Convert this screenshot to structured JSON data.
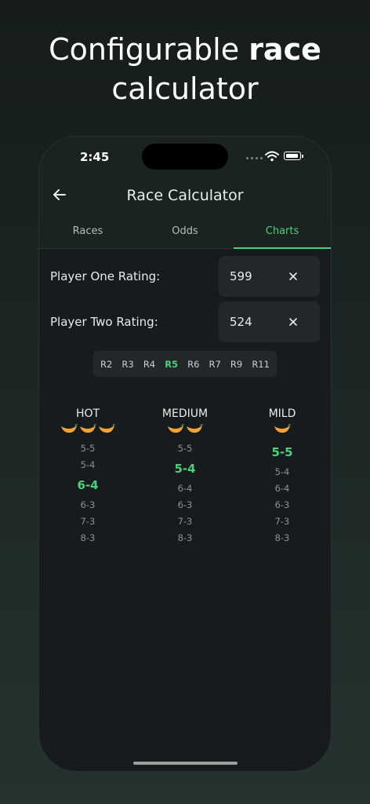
{
  "headline": {
    "regular": "Configurable ",
    "bold": "race",
    "line2": "calculator"
  },
  "status_bar": {
    "time": "2:45"
  },
  "header": {
    "title": "Race Calculator"
  },
  "tabs": [
    {
      "label": "Races",
      "active": false
    },
    {
      "label": "Odds",
      "active": false
    },
    {
      "label": "Charts",
      "active": true
    }
  ],
  "player_one": {
    "label": "Player One Rating:",
    "value": "599"
  },
  "player_two": {
    "label": "Player Two Rating:",
    "value": "524"
  },
  "races": [
    {
      "label": "R2",
      "active": false
    },
    {
      "label": "R3",
      "active": false
    },
    {
      "label": "R4",
      "active": false
    },
    {
      "label": "R5",
      "active": true
    },
    {
      "label": "R6",
      "active": false
    },
    {
      "label": "R7",
      "active": false
    },
    {
      "label": "R9",
      "active": false
    },
    {
      "label": "R11",
      "active": false
    }
  ],
  "columns": [
    {
      "title": "HOT",
      "peppers": 3,
      "entries": [
        "5-5",
        "5-4",
        "6-4",
        "6-3",
        "7-3",
        "8-3"
      ],
      "highlight": 2
    },
    {
      "title": "MEDIUM",
      "peppers": 2,
      "entries": [
        "5-5",
        "5-4",
        "6-4",
        "6-3",
        "7-3",
        "8-3"
      ],
      "highlight": 1
    },
    {
      "title": "MILD",
      "peppers": 1,
      "entries": [
        "5-5",
        "5-4",
        "6-4",
        "6-3",
        "7-3",
        "8-3"
      ],
      "highlight": 0
    }
  ],
  "colors": {
    "accent": "#4fcf7b",
    "pepper": "#f2a33a",
    "background": "#181b1e"
  }
}
